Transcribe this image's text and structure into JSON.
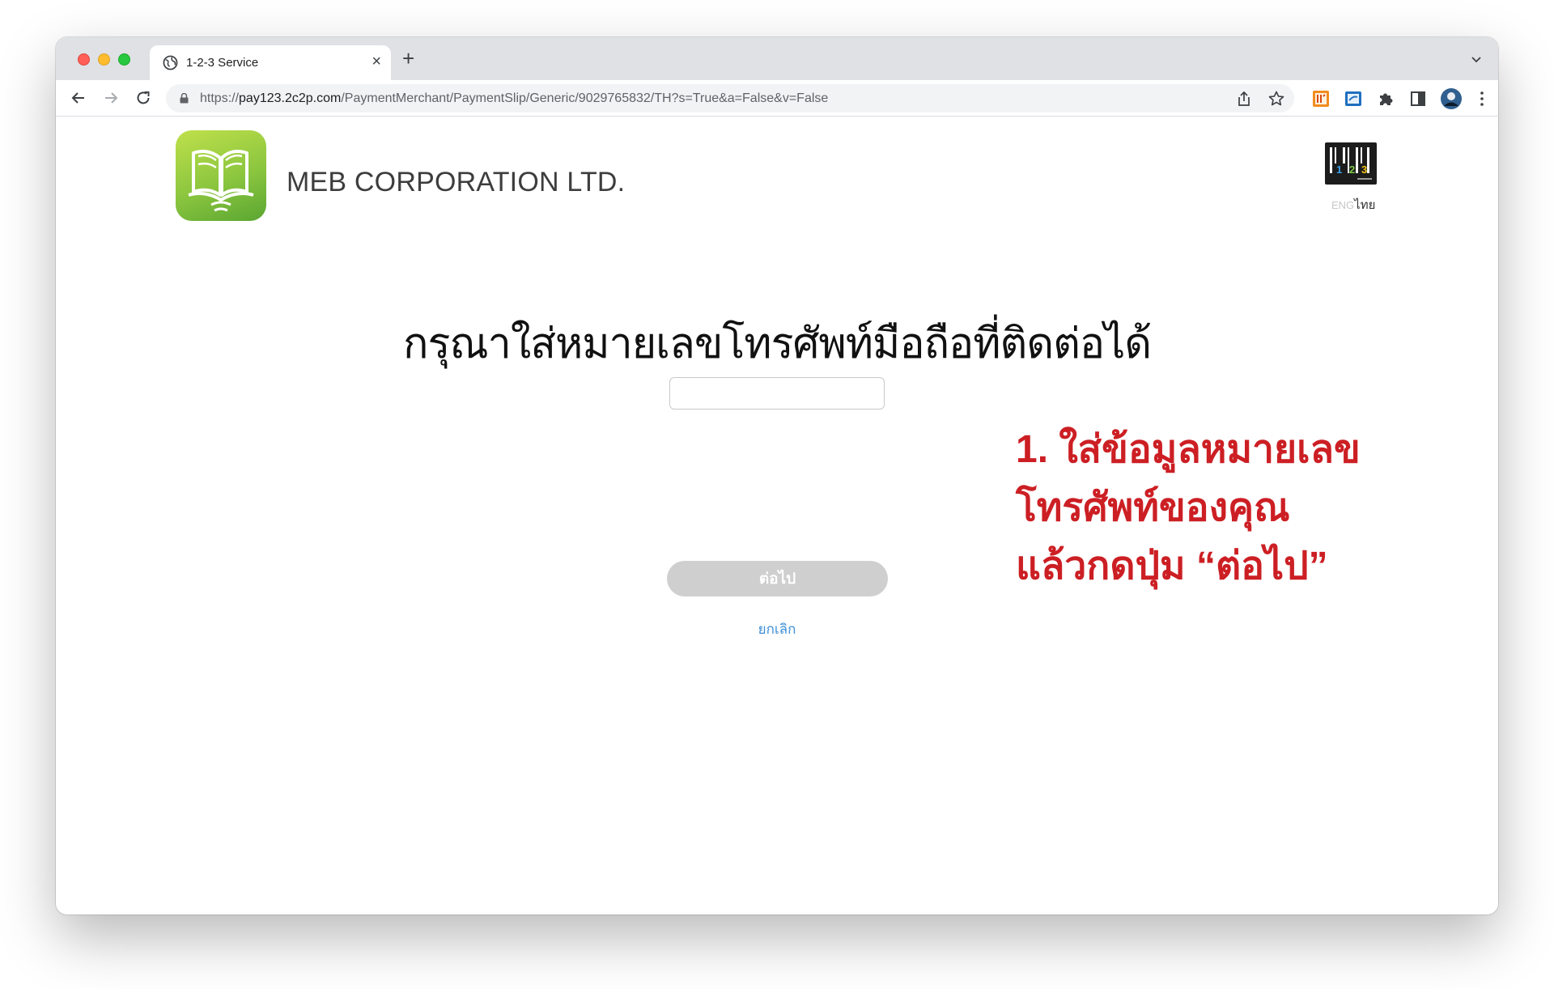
{
  "browser": {
    "tab_title": "1-2-3 Service",
    "tab_close": "×",
    "new_tab": "+",
    "url_scheme": "https://",
    "url_host": "pay123.2c2p.com",
    "url_path": "/PaymentMerchant/PaymentSlip/Generic/9029765832/TH?s=True&a=False&v=False",
    "icons": [
      "globe-icon",
      "back-arrow-icon",
      "forward-arrow-icon",
      "reload-icon",
      "lock-icon",
      "share-icon",
      "bookmark-star-icon",
      "extension-icons",
      "puzzle-icon",
      "side-panel-icon",
      "profile-avatar",
      "kebab-menu-icon",
      "tab-search-chevron-icon"
    ]
  },
  "header": {
    "company_name": "MEB CORPORATION LTD.",
    "brand_logo": "1 2 3",
    "lang_eng": "ENG",
    "lang_thai": "ไทย"
  },
  "form": {
    "heading": "กรุณาใส่หมายเลขโทรศัพท์มือถือที่ติดต่อได้",
    "phone_value": "",
    "next_label": "ต่อไป",
    "cancel_label": "ยกเลิก"
  },
  "annotation": {
    "line1": "1. ใส่ข้อมูลหมายเลข",
    "line2": "โทรศัพท์ของคุณ",
    "line3": "แล้วกดปุ่ม “ต่อไป”"
  },
  "colors": {
    "annotation_red": "#cc1f24",
    "link_blue": "#3d8fd6",
    "disabled_button": "#cfcfcf"
  }
}
